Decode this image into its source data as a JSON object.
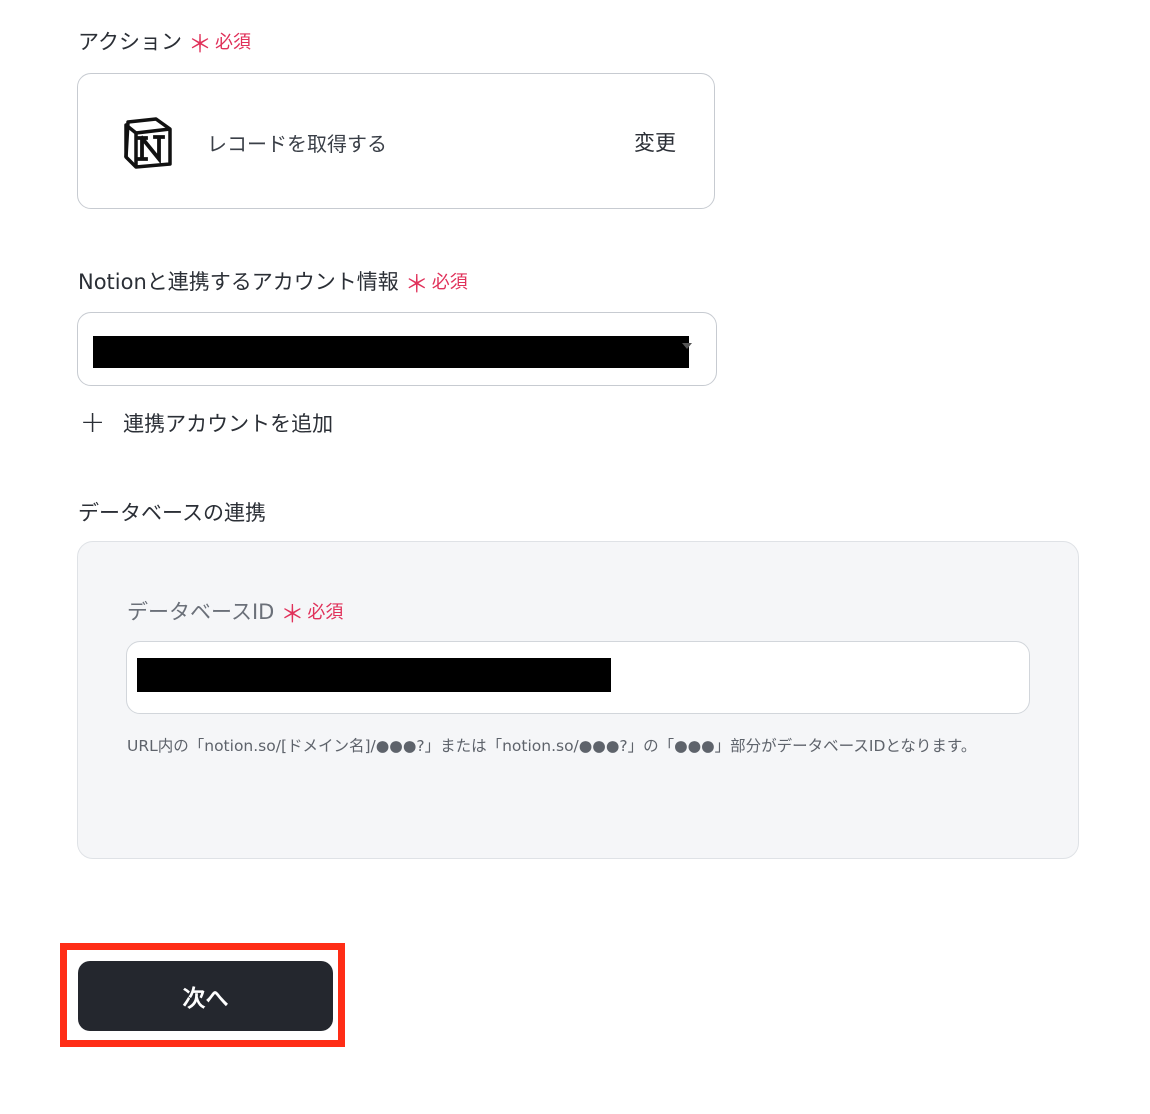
{
  "action_section": {
    "label": "アクション",
    "required_mark": "＊",
    "required_text": "必須",
    "action_name": "レコードを取得する",
    "change_label": "変更",
    "app_icon": "notion-logo-icon"
  },
  "account_section": {
    "label": "Notionと連携するアカウント情報",
    "required_mark": "＊",
    "required_text": "必須",
    "add_account_label": "連携アカウントを追加"
  },
  "database_section": {
    "heading": "データベースの連携",
    "field_label": "データベースID",
    "required_mark": "＊",
    "required_text": "必須",
    "help_text": "URL内の「notion.so/[ドメイン名]/●●●?」または「notion.so/●●●?」の「●●●」部分がデータベースIDとなります。"
  },
  "footer": {
    "next_label": "次へ"
  },
  "colors": {
    "required": "#e0315a",
    "button_bg": "#24272e",
    "highlight_border": "#ff2d16",
    "panel_bg": "#f5f6f8"
  }
}
